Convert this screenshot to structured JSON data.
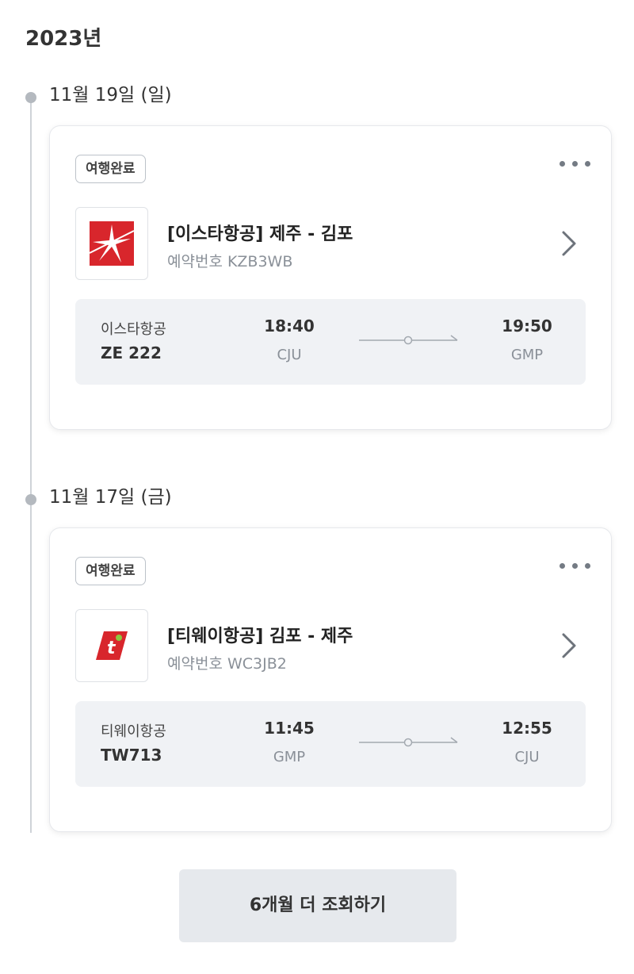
{
  "year": "2023년",
  "trips": [
    {
      "date": "11월 19일 (일)",
      "badge": "여행완료",
      "title": "[이스타항공] 제주 - 김포",
      "booking": "예약번호 KZB3WB",
      "airline": "이스타항공",
      "flight_no": "ZE 222",
      "dep_time": "18:40",
      "dep_code": "CJU",
      "arr_time": "19:50",
      "arr_code": "GMP",
      "logo": "eastar-jet-logo",
      "logo_color": "#d8262c"
    },
    {
      "date": "11월 17일 (금)",
      "badge": "여행완료",
      "title": "[티웨이항공] 김포 - 제주",
      "booking": "예약번호 WC3JB2",
      "airline": "티웨이항공",
      "flight_no": "TW713",
      "dep_time": "11:45",
      "dep_code": "GMP",
      "arr_time": "12:55",
      "arr_code": "CJU",
      "logo": "tway-logo",
      "logo_color": "#d8262c"
    }
  ],
  "load_more_label": "6개월 더 조회하기"
}
